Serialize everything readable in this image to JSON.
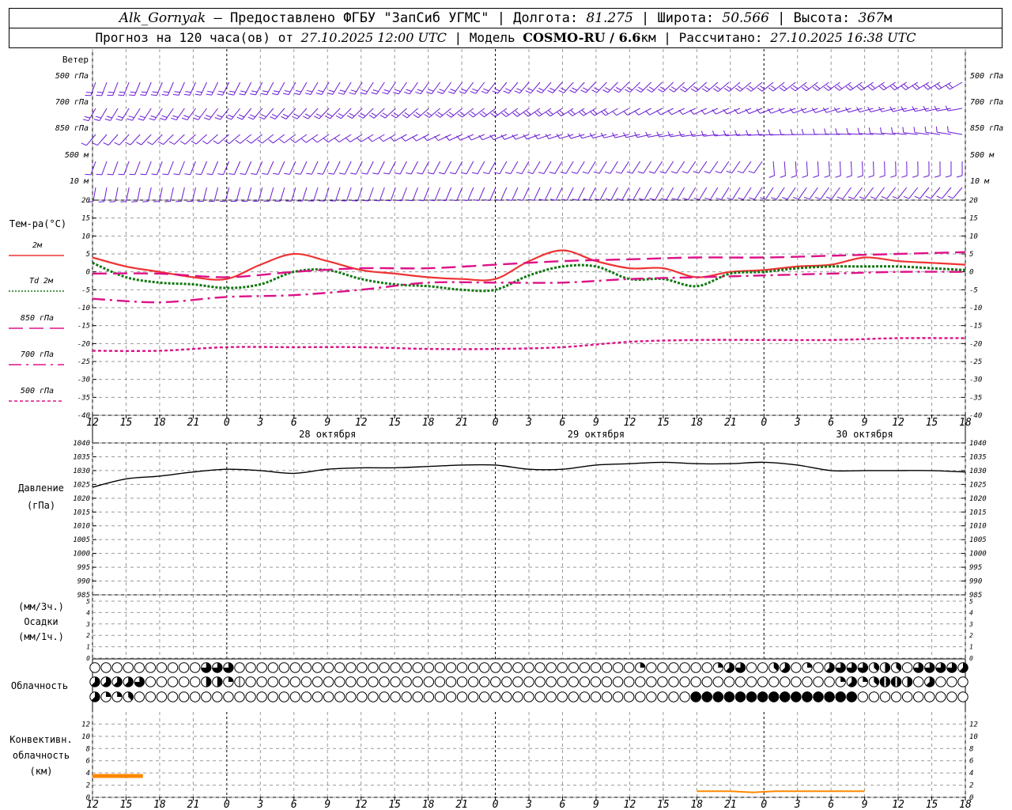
{
  "header": {
    "station": "Alk_Gornyak",
    "provider_sep": " – ",
    "provider": "Предоставлено ФГБУ \"ЗапСиб УГМС\"",
    "lon_label": "Долгота:",
    "lon": "81.275",
    "lat_label": "Широта:",
    "lat": "50.566",
    "alt_label": "Высота:",
    "alt": "367",
    "alt_unit": "м",
    "forecast_prefix": "Прогноз на 120 часа(ов) от",
    "forecast_from": "27.10.2025 12:00 UTC",
    "model_label": "Модель",
    "model": "COSMO-RU / 6.6",
    "model_unit": "км",
    "computed_label": "Рассчитано:",
    "computed": "27.10.2025 16:38 UTC"
  },
  "wind_panel": {
    "title": "Ветер",
    "levels": [
      "500 гПа",
      "700 гПа",
      "850 гПа",
      "500 м",
      "10  м"
    ]
  },
  "temp_panel": {
    "title": "Тем-ра(°C)",
    "legend": [
      {
        "label": "2м",
        "color": "#ee3333",
        "dash": "solid"
      },
      {
        "label": "Td  2м",
        "color": "#117711",
        "dash": "dot"
      },
      {
        "label": "850 гПа",
        "color": "#dd1188",
        "dash": "long-dash"
      },
      {
        "label": "700 гПа",
        "color": "#dd1188",
        "dash": "dash-dot"
      },
      {
        "label": "500 гПа",
        "color": "#dd1188",
        "dash": "short-dash"
      }
    ]
  },
  "pressure_panel": {
    "title": "Давление",
    "unit": "(гПа)"
  },
  "precip_panel": {
    "line1": "(мм/3ч.)",
    "line2": "Осадки",
    "line3": "(мм/1ч.)"
  },
  "cloud_panel": {
    "title": "Облачность"
  },
  "conv_panel": {
    "line1": "Конвективн.",
    "line2": "облачность",
    "line3": "(км)"
  },
  "x_axis": {
    "hour_labels": [
      "12",
      "15",
      "18",
      "21",
      "0",
      "3",
      "6",
      "9",
      "12",
      "15",
      "18",
      "21",
      "0",
      "3",
      "6",
      "9",
      "12",
      "15",
      "18",
      "21",
      "0",
      "3",
      "6",
      "9",
      "12",
      "15",
      "18"
    ],
    "day_labels": [
      {
        "text": "28 октября",
        "at_hour": 21
      },
      {
        "text": "29 октября",
        "at_hour": 45
      },
      {
        "text": "30 октября",
        "at_hour": 69
      }
    ]
  },
  "chart_data": [
    {
      "type": "line",
      "title": "Тем-ра(°C)",
      "x_unit": "hours since 27.10.2025 12:00 UTC",
      "xlim": [
        0,
        78
      ],
      "ylim": [
        -40,
        20
      ],
      "y_ticks": [
        -40,
        -35,
        -30,
        -25,
        -20,
        -15,
        -10,
        -5,
        0,
        5,
        10,
        15,
        20
      ],
      "grid": true,
      "series": [
        {
          "name": "2м",
          "color": "#ee3333",
          "style": "solid",
          "x": [
            0,
            3,
            6,
            9,
            12,
            15,
            18,
            21,
            24,
            27,
            30,
            33,
            36,
            39,
            42,
            45,
            48,
            51,
            54,
            57,
            60,
            63,
            66,
            69,
            72,
            75,
            78
          ],
          "y": [
            4,
            1.5,
            0,
            -1.5,
            -2,
            2,
            5,
            3,
            0.5,
            -0.5,
            -1.5,
            -2,
            -2,
            3,
            6,
            3,
            1,
            1,
            -1.5,
            0,
            0.5,
            1.5,
            2,
            4,
            3,
            2.5,
            2
          ]
        },
        {
          "name": "Td  2м",
          "color": "#117711",
          "style": "dot",
          "x": [
            0,
            3,
            6,
            9,
            12,
            15,
            18,
            21,
            24,
            27,
            30,
            33,
            36,
            39,
            42,
            45,
            48,
            51,
            54,
            57,
            60,
            63,
            66,
            69,
            72,
            75,
            78
          ],
          "y": [
            2.5,
            -1.5,
            -3,
            -3.5,
            -4.5,
            -3.5,
            0,
            0.5,
            -2,
            -3.5,
            -4,
            -5,
            -5,
            -1,
            1.5,
            1.5,
            -2,
            -2,
            -4,
            -0.5,
            0,
            1,
            1.5,
            1.5,
            1.5,
            1,
            0.5
          ]
        },
        {
          "name": "850 гПа",
          "color": "#dd1188",
          "style": "long-dash",
          "x": [
            0,
            6,
            12,
            18,
            24,
            30,
            36,
            42,
            48,
            54,
            60,
            66,
            72,
            78
          ],
          "y": [
            -0.5,
            -0.5,
            -1.5,
            0,
            1,
            1,
            2,
            3,
            3.5,
            4,
            4,
            4.5,
            5,
            5.5
          ]
        },
        {
          "name": "700 гПа",
          "color": "#dd1188",
          "style": "dash-dot",
          "x": [
            0,
            6,
            12,
            18,
            24,
            30,
            36,
            42,
            48,
            54,
            60,
            66,
            72,
            78
          ],
          "y": [
            -7.5,
            -8.5,
            -7,
            -6.5,
            -5,
            -3,
            -3,
            -3,
            -2,
            -1.5,
            -1,
            -0.5,
            0,
            0
          ]
        },
        {
          "name": "500 гПа",
          "color": "#dd1188",
          "style": "short-dash",
          "x": [
            0,
            6,
            12,
            18,
            24,
            30,
            36,
            42,
            48,
            54,
            60,
            66,
            72,
            78
          ],
          "y": [
            -22,
            -22,
            -21,
            -21,
            -21,
            -21.5,
            -21.5,
            -21,
            -19.5,
            -19,
            -19,
            -19,
            -18.5,
            -18.5
          ]
        }
      ]
    },
    {
      "type": "line",
      "title": "Давление",
      "ylabel": "(гПа)",
      "xlim": [
        0,
        78
      ],
      "ylim": [
        985,
        1040
      ],
      "y_ticks": [
        985,
        990,
        995,
        1000,
        1005,
        1010,
        1015,
        1020,
        1025,
        1030,
        1035,
        1040
      ],
      "grid": true,
      "series": [
        {
          "color": "#000000",
          "x": [
            0,
            3,
            6,
            9,
            12,
            15,
            18,
            21,
            24,
            27,
            30,
            33,
            36,
            39,
            42,
            45,
            48,
            51,
            54,
            57,
            60,
            63,
            66,
            69,
            72,
            75,
            78
          ],
          "y": [
            1024,
            1027,
            1028,
            1029.5,
            1030.5,
            1030,
            1029,
            1030.5,
            1031,
            1031,
            1031.5,
            1032,
            1032,
            1030.5,
            1030.5,
            1032,
            1032.5,
            1033,
            1032.5,
            1032.5,
            1033,
            1032,
            1030,
            1030,
            1030,
            1030,
            1029.5
          ]
        }
      ]
    },
    {
      "type": "bar",
      "title": "Осадки",
      "ylim": [
        0,
        5
      ],
      "y_ticks": [
        0,
        1,
        2,
        3,
        4,
        5
      ],
      "grid": true,
      "series": []
    },
    {
      "type": "scatter",
      "title": "Облачность",
      "note": "cloud cover octas, 3 layers x 79 hourly steps",
      "rows": [
        {
          "layer": "upper",
          "overrides": [
            {
              "from": 10,
              "to": 12,
              "v": 6
            },
            {
              "from": 49,
              "to": 49,
              "v": 2
            },
            {
              "from": 56,
              "to": 56,
              "v": 2
            },
            {
              "from": 57,
              "to": 57,
              "v": 5
            },
            {
              "from": 58,
              "to": 58,
              "v": 6
            },
            {
              "from": 61,
              "to": 61,
              "v": 3
            },
            {
              "from": 62,
              "to": 62,
              "v": 5
            },
            {
              "from": 64,
              "to": 64,
              "v": 2
            },
            {
              "from": 66,
              "to": 66,
              "v": 5
            },
            {
              "from": 67,
              "to": 69,
              "v": 6
            },
            {
              "from": 70,
              "to": 70,
              "v": 3
            },
            {
              "from": 71,
              "to": 71,
              "v": 4
            },
            {
              "from": 72,
              "to": 72,
              "v": 3
            },
            {
              "from": 74,
              "to": 77,
              "v": 6
            },
            {
              "from": 78,
              "to": 78,
              "v": 5
            }
          ]
        },
        {
          "layer": "middle",
          "overrides": [
            {
              "from": 0,
              "to": 3,
              "v": 5
            },
            {
              "from": 4,
              "to": 4,
              "v": 6
            },
            {
              "from": 10,
              "to": 11,
              "v": 4
            },
            {
              "from": 12,
              "to": 12,
              "v": 2
            },
            {
              "from": 13,
              "to": 13,
              "v": 1
            },
            {
              "from": 67,
              "to": 67,
              "v": 2
            },
            {
              "from": 68,
              "to": 68,
              "v": 5
            },
            {
              "from": 69,
              "to": 69,
              "v": 2
            },
            {
              "from": 70,
              "to": 70,
              "v": 3
            },
            {
              "from": 71,
              "to": 72,
              "v": 7
            },
            {
              "from": 73,
              "to": 73,
              "v": 4
            },
            {
              "from": 75,
              "to": 75,
              "v": 5
            }
          ]
        },
        {
          "layer": "lower",
          "overrides": [
            {
              "from": 0,
              "to": 0,
              "v": 5
            },
            {
              "from": 1,
              "to": 2,
              "v": 2
            },
            {
              "from": 3,
              "to": 3,
              "v": 3
            },
            {
              "from": 54,
              "to": 68,
              "v": 8
            }
          ]
        }
      ]
    },
    {
      "type": "line",
      "title": "Конвективн. облачность",
      "ylabel": "(км)",
      "xlim": [
        0,
        78
      ],
      "ylim": [
        0,
        14
      ],
      "y_ticks": [
        0,
        2,
        4,
        6,
        8,
        10,
        12
      ],
      "grid": true,
      "series": [
        {
          "color": "#ff8800",
          "x": [
            0,
            4.5
          ],
          "y": [
            3.5,
            3.5
          ],
          "width": 5
        },
        {
          "color": "#ff8800",
          "x": [
            54,
            57,
            59,
            61,
            63,
            66,
            69
          ],
          "y": [
            1,
            1,
            0.8,
            1,
            1,
            1,
            1
          ],
          "width": 2
        }
      ]
    }
  ]
}
